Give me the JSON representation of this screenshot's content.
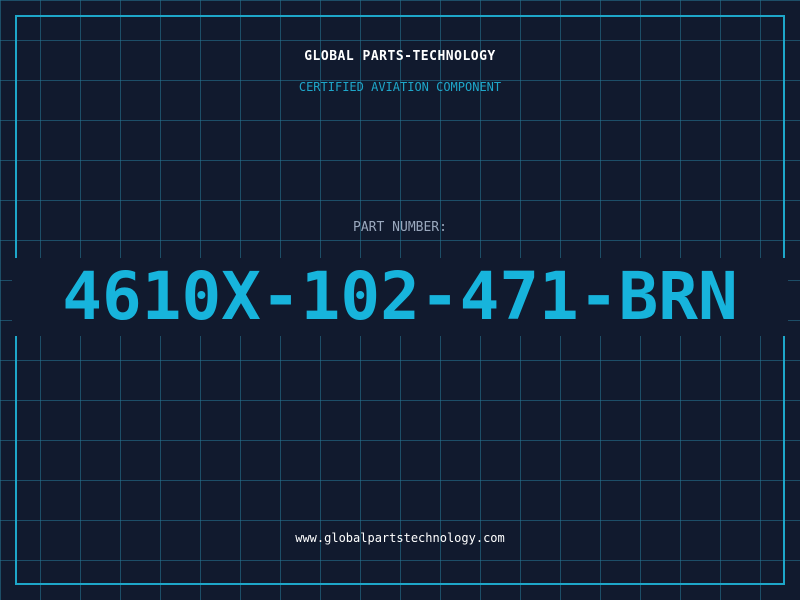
{
  "header": {
    "company": "GLOBAL PARTS-TECHNOLOGY",
    "tagline": "CERTIFIED AVIATION COMPONENT"
  },
  "part": {
    "label": "PART NUMBER:",
    "number": "4610X-102-471-BRN"
  },
  "footer": {
    "url": "www.globalpartstechnology.com"
  },
  "colors": {
    "background": "#111a2e",
    "grid": "#26789a",
    "accent": "#17b4dc",
    "text": "#ffffff",
    "muted": "#9aa8bd"
  }
}
